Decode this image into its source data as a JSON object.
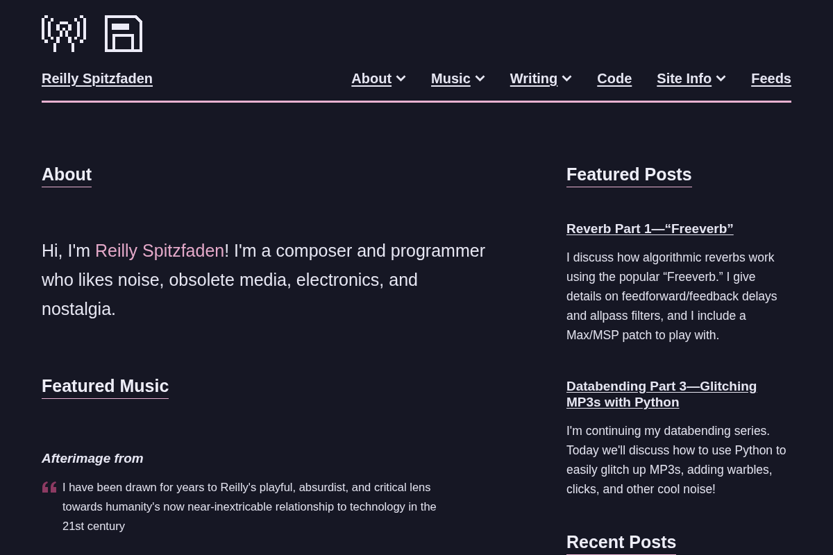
{
  "header": {
    "site_title": "Reilly Spitzfaden"
  },
  "nav": [
    {
      "label": "About",
      "dropdown": true
    },
    {
      "label": "Music",
      "dropdown": true
    },
    {
      "label": "Writing",
      "dropdown": true
    },
    {
      "label": "Code",
      "dropdown": false
    },
    {
      "label": "Site Info",
      "dropdown": true
    },
    {
      "label": "Feeds",
      "dropdown": false
    }
  ],
  "about": {
    "heading": "About",
    "intro_before": "Hi, I'm ",
    "intro_link": "Reilly Spitzfaden",
    "intro_after": "! I'm a composer and programmer who likes noise, obsolete media, electronics, and nostalgia."
  },
  "featured_music": {
    "heading": "Featured Music",
    "title": "Afterimage from",
    "quote": "I have been drawn for years to Reilly's playful, absurdist, and critical lens towards humanity's now near-inextricable relationship to technology in the 21st century"
  },
  "featured_posts": {
    "heading": "Featured Posts",
    "posts": [
      {
        "title": "Reverb Part 1—“Freeverb”",
        "summary": "I discuss how algorithmic reverbs work using the popular “Freeverb.” I give details on feedforward/feedback delays and allpass filters, and I include a Max/MSP patch to play with."
      },
      {
        "title": "Databending Part 3—Glitching MP3s with Python",
        "summary": "I'm continuing my databending series. Today we'll discuss how to use Python to easily glitch up MP3s, adding warbles, clicks, and other cool noise!"
      }
    ]
  },
  "recent_posts": {
    "heading": "Recent Posts"
  }
}
